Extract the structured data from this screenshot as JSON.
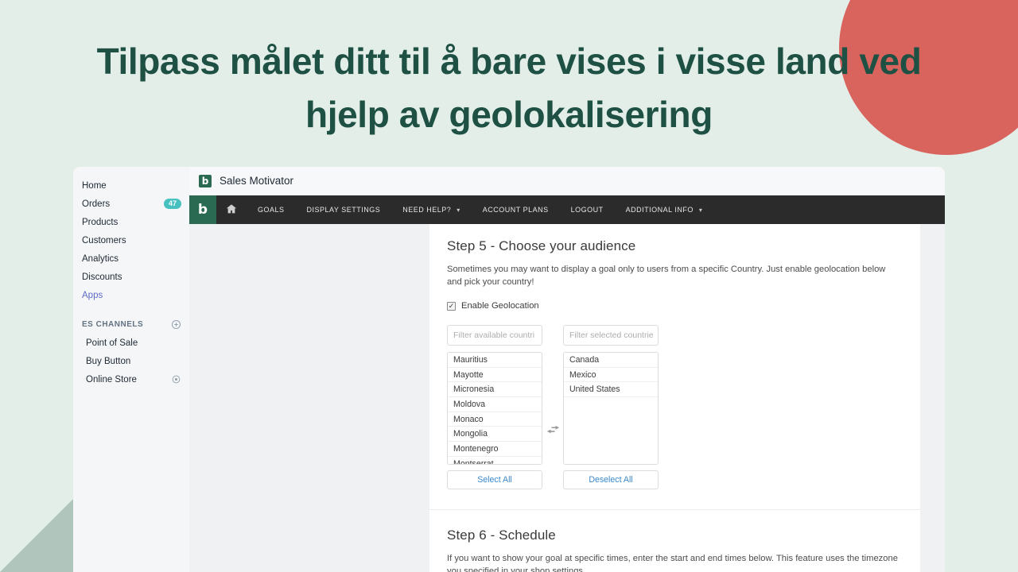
{
  "hero": {
    "line1": "Tilpass målet ditt til å bare vises i visse land ved",
    "line2": "hjelp av geolokalisering",
    "color": "#1e5144"
  },
  "decor": {
    "background": "#e3eee8",
    "circle_color": "#d9645e",
    "triangle_color": "#b0c6bd"
  },
  "shop_sidebar": {
    "items": [
      {
        "label": "Home",
        "badge": ""
      },
      {
        "label": "Orders",
        "badge": "47"
      },
      {
        "label": "Products",
        "badge": ""
      },
      {
        "label": "Customers",
        "badge": ""
      },
      {
        "label": "Analytics",
        "badge": ""
      },
      {
        "label": "Discounts",
        "badge": ""
      },
      {
        "label": "Apps",
        "badge": ""
      }
    ],
    "section": {
      "title": "ES CHANNELS",
      "add_icon": "plus-circle-icon"
    },
    "channels": [
      {
        "label": "Point of Sale",
        "icon": ""
      },
      {
        "label": "Buy Button",
        "icon": ""
      },
      {
        "label": "Online Store",
        "icon": "eye-icon"
      }
    ]
  },
  "app": {
    "titlebar": {
      "logo_letter": "b",
      "title": "Sales Motivator"
    },
    "navbar": {
      "brand_letter": "b",
      "links": [
        {
          "label": "",
          "icon": "home-icon",
          "caret": false
        },
        {
          "label": "GOALS",
          "icon": "",
          "caret": false
        },
        {
          "label": "DISPLAY SETTINGS",
          "icon": "",
          "caret": false
        },
        {
          "label": "NEED HELP?",
          "icon": "",
          "caret": true
        },
        {
          "label": "ACCOUNT PLANS",
          "icon": "",
          "caret": false
        },
        {
          "label": "LOGOUT",
          "icon": "",
          "caret": false
        },
        {
          "label": "ADDITIONAL INFO",
          "icon": "",
          "caret": true
        }
      ]
    }
  },
  "step5": {
    "title": "Step 5 - Choose your audience",
    "description": "Sometimes you may want to display a goal only to users from a specific Country. Just enable geolocation below and pick your country!",
    "checkbox_label": "Enable Geolocation",
    "checkbox_checked": true,
    "available": {
      "filter_placeholder": "Filter available countri",
      "options": [
        "Mauritius",
        "Mayotte",
        "Micronesia",
        "Moldova",
        "Monaco",
        "Mongolia",
        "Montenegro",
        "Montserrat"
      ],
      "action_label": "Select All"
    },
    "swap_icon": "exchange-arrows-icon",
    "selected": {
      "filter_placeholder": "Filter selected countrie",
      "options": [
        "Canada",
        "Mexico",
        "United States"
      ],
      "action_label": "Deselect All"
    }
  },
  "step6": {
    "title": "Step 6 - Schedule",
    "description": "If you want to show your goal at specific times, enter the start and end times below. This feature uses the timezone you specified in your shop settings."
  }
}
